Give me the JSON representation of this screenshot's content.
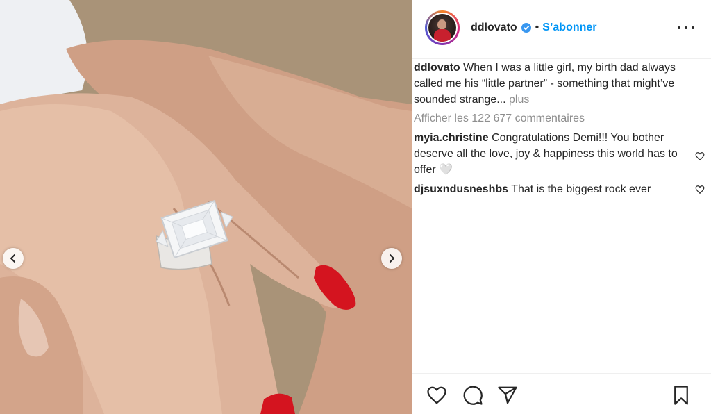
{
  "post": {
    "username": "ddlovato",
    "verified_icon": "verified-badge-icon",
    "separator": "•",
    "follow_label": "S’abonner",
    "more_icon": "more-options-icon"
  },
  "caption": {
    "username": "ddlovato",
    "text": "When I was a little girl, my birth dad always called me his “little partner” - something that might’ve sounded strange...",
    "more_label": "plus"
  },
  "view_all_comments": "Afficher les 122 677 commentaires",
  "comments": [
    {
      "username": "myia.christine",
      "text": "Congratulations Demi!!! You bother deserve all the love, joy & happiness this world has to offer 🤍"
    },
    {
      "username": "djsuxndusneshbs",
      "text": "That is the biggest rock ever"
    }
  ],
  "actions": {
    "like_icon": "heart-icon",
    "comment_icon": "comment-icon",
    "share_icon": "paper-plane-icon",
    "save_icon": "bookmark-icon"
  },
  "carousel": {
    "prev_icon": "chevron-left-icon",
    "next_icon": "chevron-right-icon"
  },
  "colors": {
    "link_blue": "#0095f6",
    "verified_blue": "#3897f0",
    "secondary_text": "#8e8e8e",
    "nail_red": "#d4141f"
  }
}
